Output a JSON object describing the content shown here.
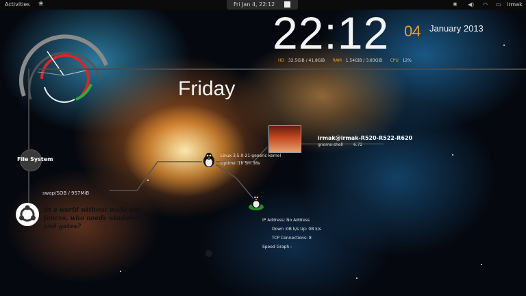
{
  "top_panel": {
    "activities_label": "Activities",
    "clock_text": "Fri Jan  4, 22:12",
    "user_name": "irmak"
  },
  "clock": {
    "time": "22:12",
    "day_number": "04",
    "month_year": "January 2013",
    "weekday": "Friday"
  },
  "system_bar": {
    "hd_label": "HD",
    "hd_value": "32.5GiB / 41.8GiB",
    "ram_label": "RAM",
    "ram_value": "1.54GiB / 3.83GiB",
    "cpu_label": "CPU",
    "cpu_value": "12%"
  },
  "left_panel": {
    "file_system_label": "File System",
    "swap_text": "swap/SOB   / 957MiB"
  },
  "quote": {
    "text": "In a world without walls and fences, who needs windows and gates?"
  },
  "system_info": {
    "kernel": "Linux 3.5.0-21-generic kernel",
    "uptime": "Uptime :1h 5m 38s",
    "user_host": "irmak@irmak-R520-R522-R620",
    "top_process": "gnome-shell",
    "top_process_value": "6.72"
  },
  "network": {
    "ip_address": "IP Address: No Address",
    "down_up": "Down :0B   k/s   Up: 0B   k/s",
    "tcp": "TCP Connections: 8",
    "speed_graph": "Speed Graph :"
  },
  "colors": {
    "accent_orange": "#f0a020",
    "gauge_red": "#d8262a",
    "gauge_green": "#34a83a",
    "panel_bg": "#0b0b0b"
  }
}
